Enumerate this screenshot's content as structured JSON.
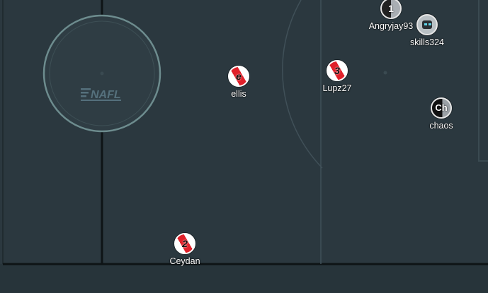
{
  "pitch": {
    "logo_text": "NAFL",
    "colors": {
      "grass": "#2b383f",
      "line": "#0e1416",
      "arc": "#4a5a63",
      "center_circle": "#6d8c8e"
    }
  },
  "players": [
    {
      "name": "Angryjay93",
      "badge": "1",
      "style": "grey"
    },
    {
      "name": "skills324",
      "badge": "",
      "style": "avatar",
      "icon": "robot-avatar-icon"
    },
    {
      "name": "ellis",
      "badge": "e",
      "style": "red-stripe"
    },
    {
      "name": "Lupz27",
      "badge": "3",
      "style": "red-stripe"
    },
    {
      "name": "chaos",
      "badge": "Ch",
      "style": "dark"
    },
    {
      "name": "Ceydan",
      "badge": "2",
      "style": "red-stripe"
    }
  ]
}
